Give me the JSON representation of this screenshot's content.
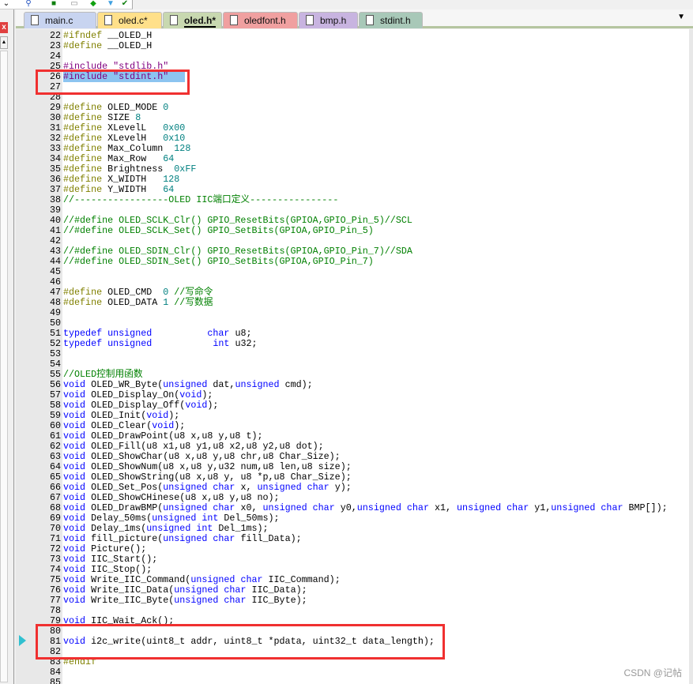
{
  "toolbar": {
    "icons": [
      "find-in-files-icon",
      "build-icon",
      "window-icon",
      "download-icon",
      "debug-icon",
      "check-icon"
    ]
  },
  "left_panel": {
    "close_label": "x"
  },
  "tabs": [
    {
      "label": "main.c",
      "color": "#c8d4f0",
      "active": false
    },
    {
      "label": "oled.c*",
      "color": "#ffe08a",
      "active": false
    },
    {
      "label": "oled.h*",
      "color": "#c8d8b0",
      "active": true
    },
    {
      "label": "oledfont.h",
      "color": "#f0a0a0",
      "active": false
    },
    {
      "label": "bmp.h",
      "color": "#c8b4e0",
      "active": false
    },
    {
      "label": "stdint.h",
      "color": "#a8c8b8",
      "active": false
    }
  ],
  "editor": {
    "first_line": 22,
    "selected_line": 26,
    "current_line_marker": 81,
    "highlight_boxes": [
      [
        26,
        27
      ],
      [
        80,
        82
      ]
    ],
    "lines": [
      "#ifndef __OLED_H",
      "#define __OLED_H",
      "",
      "#include \"stdlib.h\"",
      "#include \"stdint.h\"",
      "",
      "",
      "#define OLED_MODE 0",
      "#define SIZE 8",
      "#define XLevelL   0x00",
      "#define XLevelH   0x10",
      "#define Max_Column  128",
      "#define Max_Row   64",
      "#define Brightness  0xFF",
      "#define X_WIDTH   128",
      "#define Y_WIDTH   64",
      "//-----------------OLED IIC端口定义----------------",
      "",
      "//#define OLED_SCLK_Clr() GPIO_ResetBits(GPIOA,GPIO_Pin_5)//SCL",
      "//#define OLED_SCLK_Set() GPIO_SetBits(GPIOA,GPIO_Pin_5)",
      "",
      "//#define OLED_SDIN_Clr() GPIO_ResetBits(GPIOA,GPIO_Pin_7)//SDA",
      "//#define OLED_SDIN_Set() GPIO_SetBits(GPIOA,GPIO_Pin_7)",
      "",
      "",
      "#define OLED_CMD  0 //写命令",
      "#define OLED_DATA 1 //写数据",
      "",
      "",
      "typedef unsigned          char u8;",
      "typedef unsigned           int u32;",
      "",
      "",
      "//OLED控制用函数",
      "void OLED_WR_Byte(unsigned dat,unsigned cmd);",
      "void OLED_Display_On(void);",
      "void OLED_Display_Off(void);",
      "void OLED_Init(void);",
      "void OLED_Clear(void);",
      "void OLED_DrawPoint(u8 x,u8 y,u8 t);",
      "void OLED_Fill(u8 x1,u8 y1,u8 x2,u8 y2,u8 dot);",
      "void OLED_ShowChar(u8 x,u8 y,u8 chr,u8 Char_Size);",
      "void OLED_ShowNum(u8 x,u8 y,u32 num,u8 len,u8 size);",
      "void OLED_ShowString(u8 x,u8 y, u8 *p,u8 Char_Size);",
      "void OLED_Set_Pos(unsigned char x, unsigned char y);",
      "void OLED_ShowCHinese(u8 x,u8 y,u8 no);",
      "void OLED_DrawBMP(unsigned char x0, unsigned char y0,unsigned char x1, unsigned char y1,unsigned char BMP[]);",
      "void Delay_50ms(unsigned int Del_50ms);",
      "void Delay_1ms(unsigned int Del_1ms);",
      "void fill_picture(unsigned char fill_Data);",
      "void Picture();",
      "void IIC_Start();",
      "void IIC_Stop();",
      "void Write_IIC_Command(unsigned char IIC_Command);",
      "void Write_IIC_Data(unsigned char IIC_Data);",
      "void Write_IIC_Byte(unsigned char IIC_Byte);",
      "",
      "void IIC_Wait_Ack();",
      "",
      "void i2c_write(uint8_t addr, uint8_t *pdata, uint32_t data_length);",
      "",
      "#endif",
      "",
      ""
    ]
  },
  "watermark": "CSDN @记帖"
}
